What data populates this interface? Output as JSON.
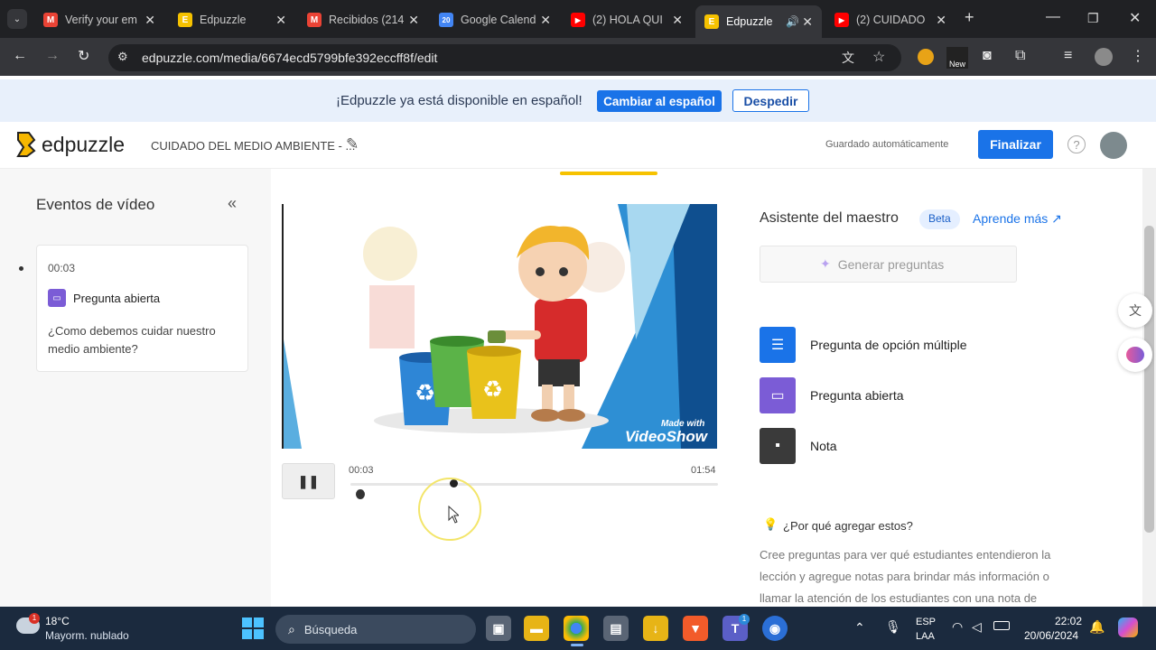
{
  "browser": {
    "tabs": [
      {
        "title": "Verify your em",
        "icon": "gmail-icon",
        "color": "#ea4335",
        "letter": "M"
      },
      {
        "title": "Edpuzzle",
        "icon": "edpuzzle-icon",
        "color": "#f6c200",
        "letter": "E"
      },
      {
        "title": "Recibidos (214",
        "icon": "gmail-icon",
        "color": "#ea4335",
        "letter": "M"
      },
      {
        "title": "Google Calend",
        "icon": "calendar-icon",
        "color": "#4285f4",
        "letter": "20"
      },
      {
        "title": "(2) HOLA QUI",
        "icon": "youtube-icon",
        "color": "#ff0000",
        "letter": "▶"
      },
      {
        "title": "Edpuzzle",
        "icon": "edpuzzle-icon",
        "color": "#f6c200",
        "letter": "E"
      },
      {
        "title": "(2) CUIDADO",
        "icon": "youtube-icon",
        "color": "#ff0000",
        "letter": "▶"
      }
    ],
    "url": "edpuzzle.com/media/6674ecd5799bfe392eccff8f/edit",
    "extension_badge": "New"
  },
  "banner": {
    "text": "¡Edpuzzle ya está disponible en español!",
    "switch_label": "Cambiar al español",
    "dismiss_label": "Despedir"
  },
  "header": {
    "logo": "edpuzzle",
    "video_title": "CUIDADO DEL MEDIO AMBIENTE - ...",
    "autosave": "Guardado automáticamente",
    "finish_label": "Finalizar",
    "help": "?"
  },
  "events": {
    "title": "Eventos de vídeo",
    "items": [
      {
        "time": "00:03",
        "type": "Pregunta abierta",
        "question": "¿Como debemos cuidar nuestro medio ambiente?"
      }
    ]
  },
  "player": {
    "current_time": "00:03",
    "duration": "01:54",
    "progress": 0.03,
    "watermark_small": "Made with",
    "watermark_brand": "VideoShow"
  },
  "assistant": {
    "title": "Asistente del maestro",
    "badge": "Beta",
    "learn_more": "Aprende más ↗",
    "generate": "Generar preguntas"
  },
  "question_types": [
    {
      "label": "Pregunta de opción múltiple",
      "icon": "multiple-choice-icon",
      "color": "#1a73e8"
    },
    {
      "label": "Pregunta abierta",
      "icon": "open-question-icon",
      "color": "#7b5cd6"
    },
    {
      "label": "Nota",
      "icon": "note-icon",
      "color": "#3a3a3a"
    }
  ],
  "why": {
    "title": "¿Por qué agregar estos?",
    "lines": [
      "Cree preguntas para ver qué estudiantes entendieron la",
      "lección y agregue notas para brindar más información o",
      "llamar la atención de los estudiantes con una nota de"
    ]
  },
  "taskbar": {
    "temp": "18°C",
    "weather": "Mayorm. nublado",
    "weather_badge": "1",
    "search": "Búsqueda",
    "lang1": "ESP",
    "lang2": "LAA",
    "time": "22:02",
    "date": "20/06/2024",
    "teams_badge": "1"
  }
}
